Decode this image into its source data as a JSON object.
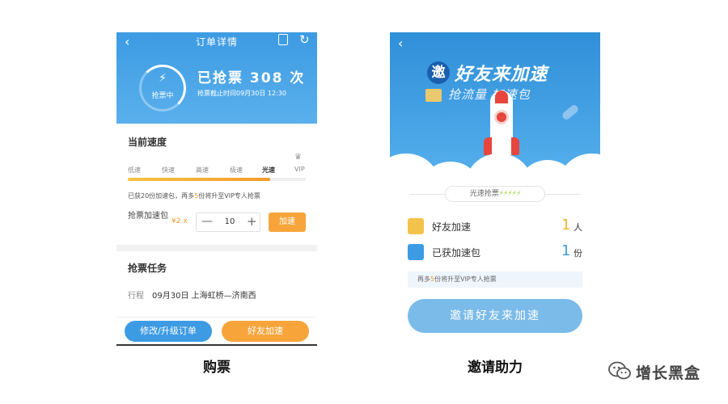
{
  "left_phone": {
    "nav_title": "订单详情",
    "nav_icon_label": "日历",
    "gauge_label": "抢票中",
    "grab_count": "已抢票 308 次",
    "deadline": "抢票截止时间09月30日 12:30",
    "speed_section_title": "当前速度",
    "speed_levels": [
      "低速",
      "快速",
      "高速",
      "极速",
      "光速",
      "VIP"
    ],
    "speed_progress": 0.8,
    "tip_prefix": "已获20份加速包，再多",
    "tip_highlight": "5",
    "tip_suffix": "份将升至VIP专人抢票",
    "package_label": "抢票加速包",
    "price": "¥2 x",
    "minus": "—",
    "quantity": "10",
    "plus": "+",
    "speed_button": "加速",
    "task_section_title": "抢票任务",
    "trip_key": "行程",
    "trip_value": "09月30日  上海虹桥—济南西",
    "modify_button": "修改/升级订单",
    "friend_button": "好友加速"
  },
  "right_phone": {
    "badge": "邀",
    "title": "好友来加速",
    "subtitle": "抢流量 加速包",
    "speed_chip": "光速抢票",
    "speed_chip_bolts": "⚡⚡⚡⚡⚡",
    "friends_label": "好友加速",
    "friends_count": "1",
    "friends_unit": "人",
    "packages_label": "已获加速包",
    "packages_count": "1",
    "packages_unit": "份",
    "tip_prefix": "再多",
    "tip_highlight": "5",
    "tip_suffix": "份将升至VIP专人抢票",
    "invite_button": "邀请好友来加速"
  },
  "captions": {
    "left": "购票",
    "right": "邀请助力"
  },
  "watermark": {
    "text": "增长黑盒"
  },
  "colors": {
    "primary_blue": "#3d9be3",
    "accent_orange": "#f7a53b",
    "count_yellow": "#f3b233",
    "count_blue": "#3d9be3"
  },
  "icons": {
    "back": "chevron-left-icon",
    "refresh": "refresh-icon",
    "calendar": "calendar-icon",
    "bolt": "lightning-icon",
    "crown": "crown-icon",
    "friend": "user-icon",
    "rocket": "rocket-icon",
    "wechat": "wechat-icon"
  }
}
